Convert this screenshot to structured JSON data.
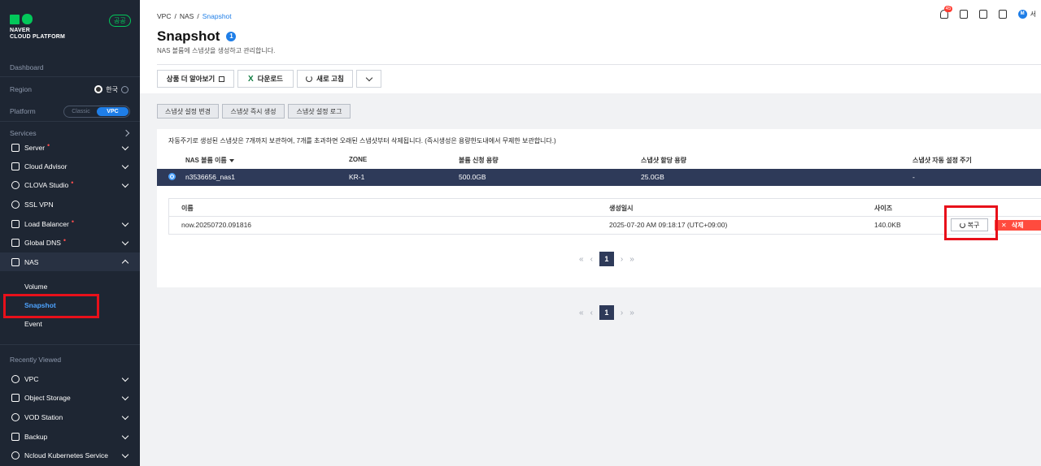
{
  "brand": {
    "line1": "NAVER",
    "line2": "CLOUD PLATFORM",
    "badge": "공공"
  },
  "sidebar": {
    "dashboard": "Dashboard",
    "region_label": "Region",
    "region_value": "한국",
    "platform_label": "Platform",
    "platform_options": [
      "Classic",
      "VPC"
    ],
    "platform_selected": "VPC",
    "services_label": "Services",
    "items": [
      {
        "label": "Server",
        "new": true
      },
      {
        "label": "Cloud Advisor",
        "new": false
      },
      {
        "label": "CLOVA Studio",
        "new": true
      },
      {
        "label": "SSL VPN",
        "new": false
      },
      {
        "label": "Load Balancer",
        "new": true
      },
      {
        "label": "Global DNS",
        "new": true
      },
      {
        "label": "NAS",
        "new": false
      }
    ],
    "nas_sub": [
      "Volume",
      "Snapshot",
      "Event"
    ],
    "recent_label": "Recently Viewed",
    "recent": [
      "VPC",
      "Object Storage",
      "VOD Station",
      "Backup",
      "Ncloud Kubernetes Service"
    ]
  },
  "header": {
    "breadcrumb": [
      "VPC",
      "/",
      "NAS",
      "/",
      "Snapshot"
    ],
    "title": "Snapshot",
    "help": "1",
    "subtitle": "NAS 볼륨에 스냅샷을 생성하고 관리합니다.",
    "notif_count": "45",
    "user_initial": "M",
    "user_name": "서"
  },
  "toolbar": {
    "learn_more": "상품 더 알아보기",
    "download": "다운로드",
    "refresh": "새로 고침"
  },
  "actions": [
    "스냅샷 설정 변경",
    "스냅샷 즉시 생성",
    "스냅샷 설정 로그"
  ],
  "panel": {
    "notice": "자동주기로 생성된 스냅샷은 7개까지 보관하여, 7개를 초과하면 오래된 스냅샷부터 삭제됩니다. (즉시생성은 용량한도내에서 무제한 보관합니다.)",
    "columns": [
      "NAS 볼륨 이름",
      "ZONE",
      "볼륨 신청 용량",
      "스냅샷 할당 용량",
      "스냅샷 자동 설정 주기"
    ],
    "row": {
      "name": "n3536656_nas1",
      "zone": "KR-1",
      "volume": "500.0GB",
      "snapshot": "25.0GB",
      "cycle": "-"
    },
    "snapshot_columns": [
      "이름",
      "생성일시",
      "사이즈"
    ],
    "snapshot_row": {
      "name": "now.20250720.091816",
      "created": "2025-07-20 AM 09:18:17 (UTC+09:00)",
      "size": "140.0KB"
    },
    "restore": "복구",
    "delete": "삭제"
  },
  "pagination": {
    "current": "1",
    "first": "«",
    "prev": "‹",
    "next": "›",
    "last": "»"
  }
}
